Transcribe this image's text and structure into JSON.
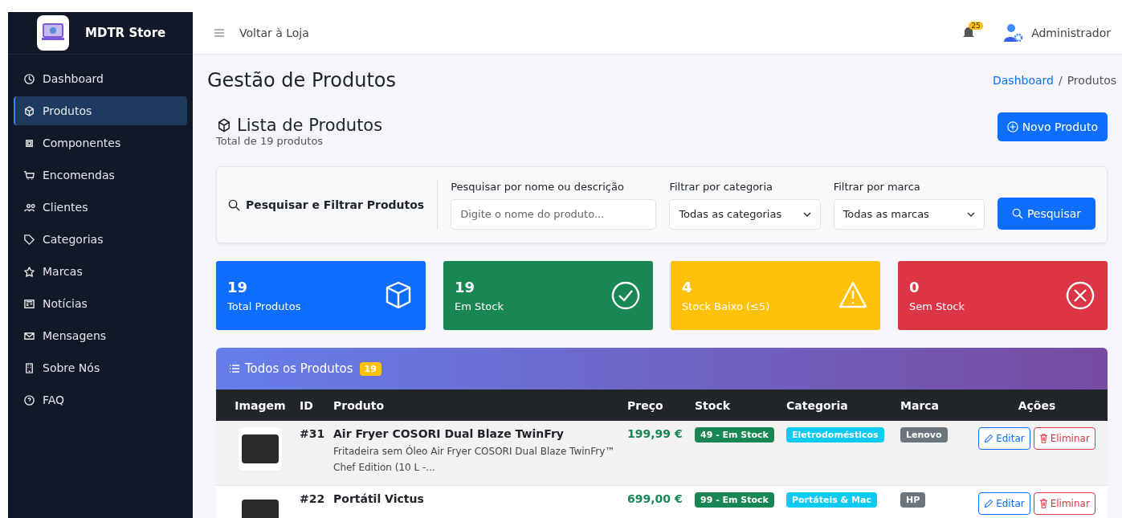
{
  "brand": {
    "name": "MDTR Store"
  },
  "topbar": {
    "back_link": "Voltar à Loja",
    "notifications": "25",
    "user": "Administrador"
  },
  "sidebar": {
    "items": [
      {
        "label": "Dashboard",
        "selected": false
      },
      {
        "label": "Produtos",
        "selected": true
      },
      {
        "label": "Componentes",
        "selected": false
      },
      {
        "label": "Encomendas",
        "selected": false
      },
      {
        "label": "Clientes",
        "selected": false
      },
      {
        "label": "Categorias",
        "selected": false
      },
      {
        "label": "Marcas",
        "selected": false
      },
      {
        "label": "Notícias",
        "selected": false
      },
      {
        "label": "Mensagens",
        "selected": false
      },
      {
        "label": "Sobre Nós",
        "selected": false
      },
      {
        "label": "FAQ",
        "selected": false
      }
    ]
  },
  "page": {
    "title": "Gestão de Produtos",
    "breadcrumb": [
      "Dashboard",
      "Produtos"
    ],
    "breadcrumb_separator": "/"
  },
  "list_header": {
    "title": "Lista de Produtos",
    "subtitle": "Total de 19 produtos",
    "new_button": "Novo Produto"
  },
  "filters": {
    "title": "Pesquisar e Filtrar Produtos",
    "search": {
      "label": "Pesquisar por nome ou descrição",
      "placeholder": "Digite o nome do produto..."
    },
    "category": {
      "label": "Filtrar por categoria",
      "value": "Todas as categorias"
    },
    "brand": {
      "label": "Filtrar por marca",
      "value": "Todas as marcas"
    },
    "button": "Pesquisar"
  },
  "stats": [
    {
      "value": "19",
      "label": "Total Produtos",
      "color": "#0d6efd"
    },
    {
      "value": "19",
      "label": "Em Stock",
      "color": "#198754"
    },
    {
      "value": "4",
      "label": "Stock Baixo (≤5)",
      "color": "#ffc107"
    },
    {
      "value": "0",
      "label": "Sem Stock",
      "color": "#dc3545"
    }
  ],
  "table": {
    "title": "Todos os Produtos",
    "count": "19",
    "columns": [
      "Imagem",
      "ID",
      "Produto",
      "Preço",
      "Stock",
      "Categoria",
      "Marca",
      "Ações"
    ],
    "rows": [
      {
        "id": "#31",
        "name": "Air Fryer COSORI Dual Blaze TwinFry",
        "description": "Fritadeira sem Óleo Air Fryer COSORI Dual Blaze TwinFry™ Chef Edition (10 L -...",
        "price": "199,99 €",
        "stock": "49 - Em Stock",
        "category": "Eletrodomésticos",
        "brand": "Lenovo",
        "edit": "Editar",
        "delete": "Eliminar"
      },
      {
        "id": "#22",
        "name": "Portátil Victus",
        "price": "699,00 €",
        "stock": "99 - Em Stock",
        "category": "Portáteis & Mac",
        "brand": "HP",
        "edit": "Editar",
        "delete": "Eliminar"
      }
    ]
  }
}
